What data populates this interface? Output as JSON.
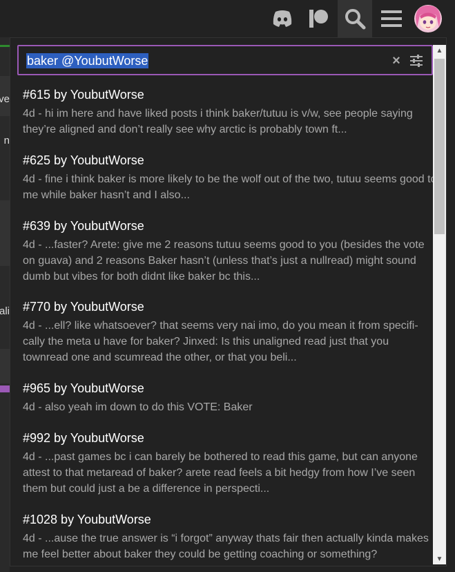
{
  "header": {
    "icons": [
      "discord-icon",
      "patreon-icon",
      "search-icon",
      "menu-icon",
      "avatar"
    ]
  },
  "background_fragments": [
    "ve",
    "n",
    "ali"
  ],
  "search": {
    "query": "baker @YoubutWorse",
    "clear_icon": "×"
  },
  "results": [
    {
      "title": "#615 by YoubutWorse",
      "snippet": "4d - hi im here and have liked posts i think baker/tutuu is v/w, see people saying they’re aligned and don’t really see why arctic is probably town ft..."
    },
    {
      "title": "#625 by YoubutWorse",
      "snippet": "4d - fine i think baker is more likely to be the wolf out of the two, tutuu seems good to me while baker hasn’t and I also..."
    },
    {
      "title": "#639 by YoubutWorse",
      "snippet": "4d - ...faster? Arete: give me 2 reasons tutuu seems good to you (besides the vote on guava) and 2 reasons Baker hasn’t (unless that’s just a nullread) might sound dumb but vibes for both didnt like baker bc this..."
    },
    {
      "title": "#770 by YoubutWorse",
      "snippet": "4d - ...ell? like whatsoever? that seems very nai imo, do you mean it from specifi-cally the meta u have for baker? Jinxed: Is this unaligned read just that you townread one and scumread the other, or that you beli..."
    },
    {
      "title": "#965 by YoubutWorse",
      "snippet": "4d - also yeah im down to do this VOTE: Baker"
    },
    {
      "title": "#992 by YoubutWorse",
      "snippet": "4d - ...past games bc i can barely be bothered to read this game, but can anyone attest to that metaread of baker? arete read feels a bit hedgy from how I’ve seen them but could just a be a difference in perspecti..."
    },
    {
      "title": "#1028 by YoubutWorse",
      "snippet": "4d - ...ause the true answer is “i forgot” anyway thats fair then actually kinda makes me feel better about baker they could be getting coaching or something?"
    }
  ],
  "colors": {
    "accent": "#9b59b6",
    "selection": "#2d5fbf",
    "background": "#222222",
    "snippet_text": "#a8a8a8"
  }
}
